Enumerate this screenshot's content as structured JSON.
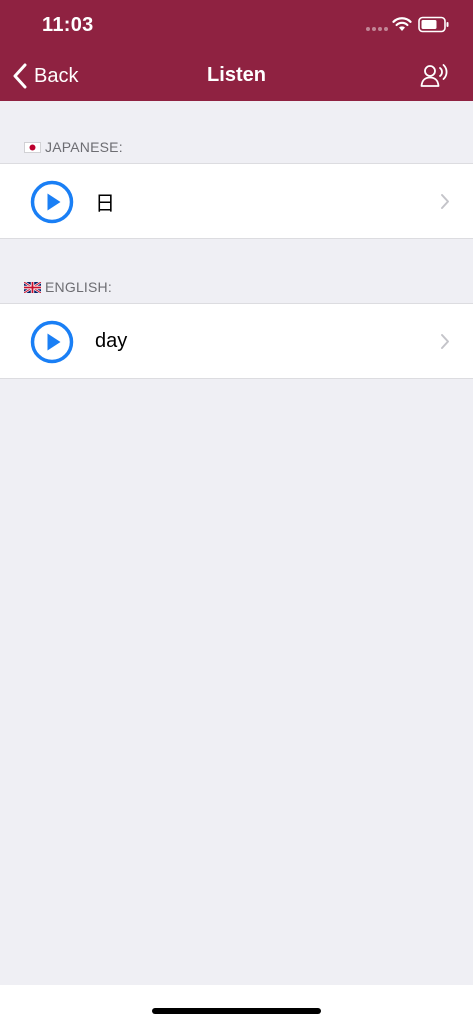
{
  "status_bar": {
    "time": "11:03"
  },
  "nav": {
    "back_label": "Back",
    "title": "Listen",
    "right_icon": "voice-listen-icon"
  },
  "sections": [
    {
      "flag": "japan-flag-icon",
      "header": "JAPANESE:",
      "text": "日"
    },
    {
      "flag": "uk-flag-icon",
      "header": "ENGLISH:",
      "text": "day"
    }
  ],
  "colors": {
    "nav_background": "#8f2241",
    "accent_blue": "#1a7ff5",
    "page_background": "#efeff4"
  }
}
